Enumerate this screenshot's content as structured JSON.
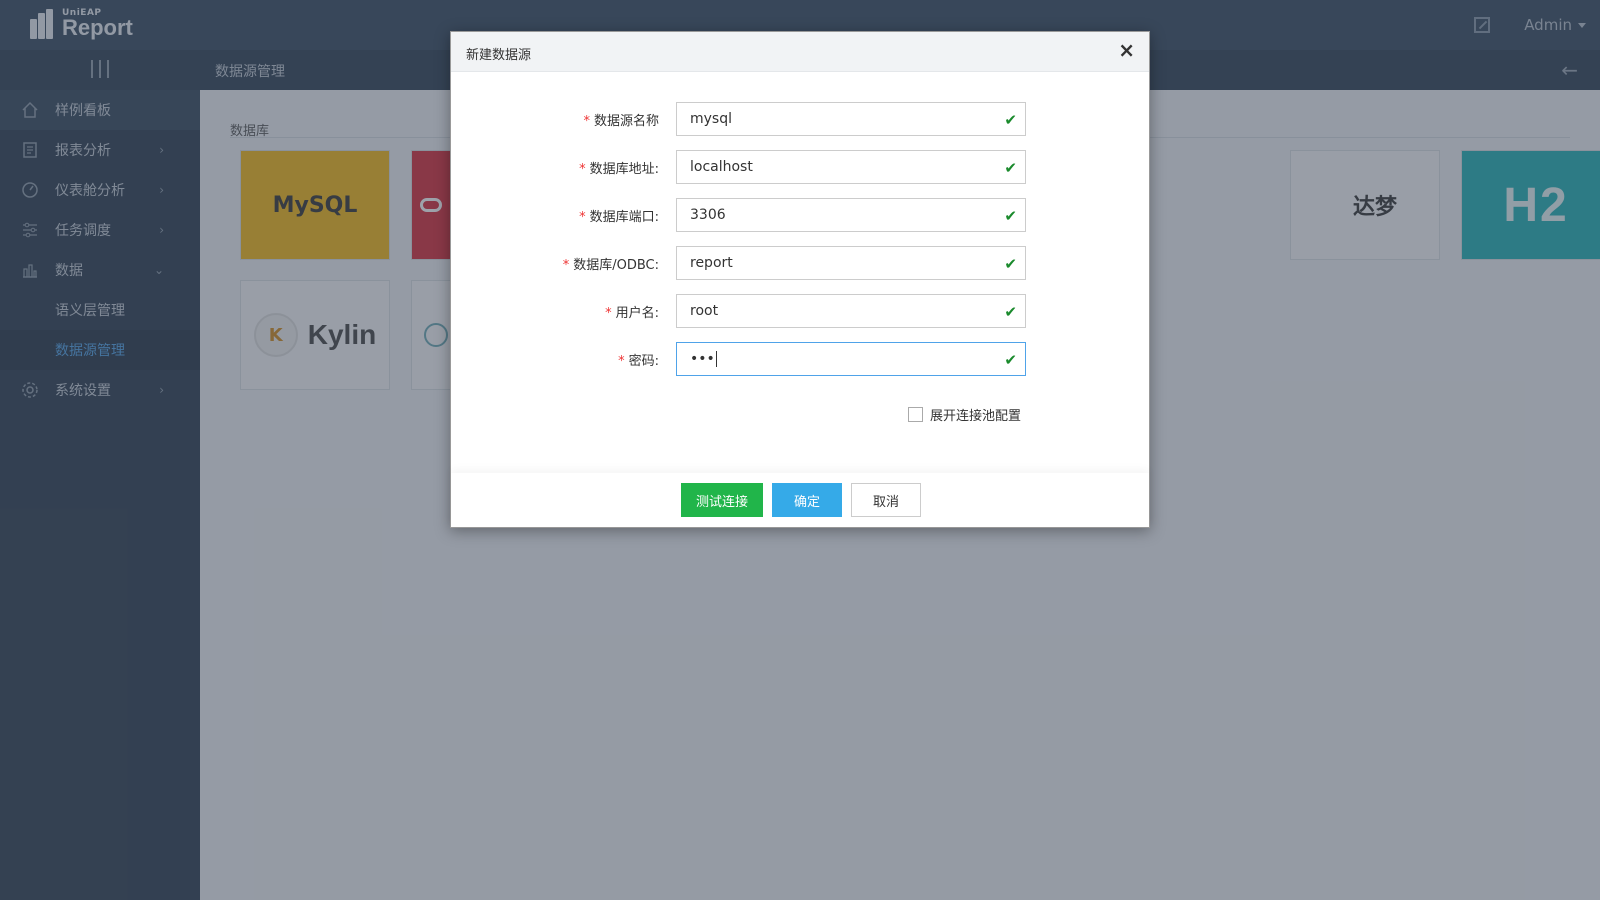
{
  "app": {
    "logo_small": "UniEAP",
    "logo_big": "Report",
    "user": "Admin"
  },
  "subbar": {
    "title": "数据源管理"
  },
  "sidebar": {
    "items": [
      {
        "label": "样例看板",
        "icon": "home-icon"
      },
      {
        "label": "报表分析",
        "icon": "report-icon"
      },
      {
        "label": "仪表舱分析",
        "icon": "gauge-icon"
      },
      {
        "label": "任务调度",
        "icon": "sliders-icon"
      },
      {
        "label": "数据",
        "icon": "bar-chart-icon"
      },
      {
        "label": "语义层管理"
      },
      {
        "label": "数据源管理"
      },
      {
        "label": "系统设置",
        "icon": "gear-icon"
      }
    ]
  },
  "main": {
    "section_label": "数据库",
    "tiles": {
      "mysql": "MySQL",
      "dm": "达梦",
      "h2": "H2",
      "kylin": "Kylin"
    }
  },
  "modal": {
    "title": "新建数据源",
    "close": "×",
    "fields": [
      {
        "label": "数据源名称",
        "value": "mysql"
      },
      {
        "label": "数据库地址:",
        "value": "localhost"
      },
      {
        "label": "数据库端口:",
        "value": "3306"
      },
      {
        "label": "数据库/ODBC:",
        "value": "report"
      },
      {
        "label": "用户名:",
        "value": "root"
      },
      {
        "label": "密码:",
        "value": "•••"
      }
    ],
    "required_mark": "*",
    "pool_checkbox_label": "展开连接池配置",
    "buttons": {
      "test": "测试连接",
      "ok": "确定",
      "cancel": "取消"
    }
  },
  "colors": {
    "accent": "#35aae8",
    "success": "#21b54a",
    "sidebar_bg": "#2b3b4e",
    "active_link": "#4fa3e9"
  }
}
